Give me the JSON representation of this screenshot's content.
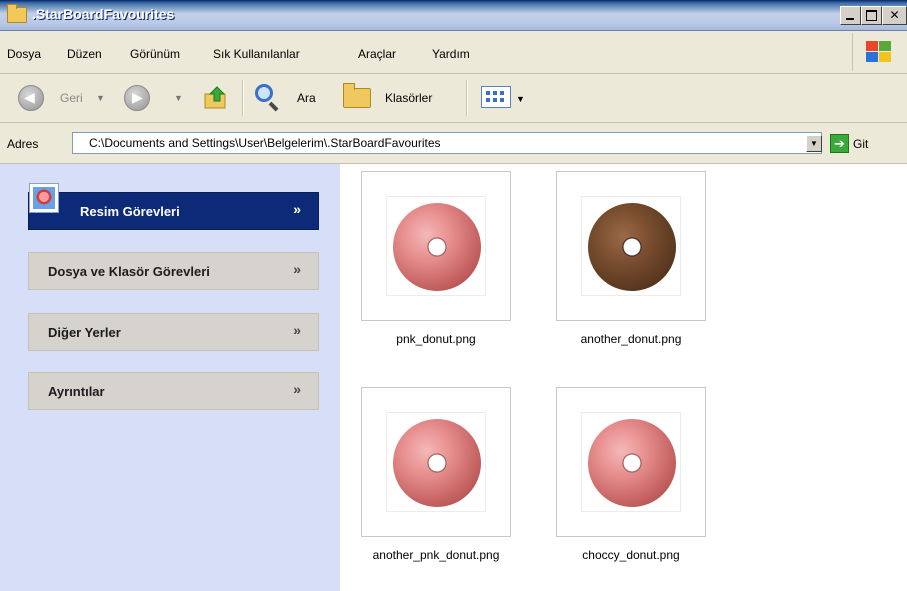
{
  "window": {
    "title": ".StarBoardFavourites"
  },
  "menu": {
    "items": [
      "Dosya",
      "Düzen",
      "Görünüm",
      "Sık Kullanılanlar",
      "Araçlar",
      "Yardım"
    ]
  },
  "toolbar": {
    "back_label": "Geri",
    "search_label": "Ara",
    "folders_label": "Klasörler"
  },
  "address": {
    "label": "Adres",
    "path": "C:\\Documents and Settings\\User\\Belgelerim\\.StarBoardFavourites",
    "go_label": "Git"
  },
  "tasks": {
    "panels": [
      {
        "title": "Resim Görevleri"
      },
      {
        "title": "Dosya ve Klasör Görevleri"
      },
      {
        "title": "Diğer Yerler"
      },
      {
        "title": "Ayrıntılar"
      }
    ]
  },
  "files": [
    {
      "name": "pnk_donut.png",
      "thumb": "pink-donut"
    },
    {
      "name": "another_donut.png",
      "thumb": "chocolate-donut"
    },
    {
      "name": "another_pnk_donut.png",
      "thumb": "pink-donut"
    },
    {
      "name": "choccy_donut.png",
      "thumb": "pink-donut"
    }
  ]
}
